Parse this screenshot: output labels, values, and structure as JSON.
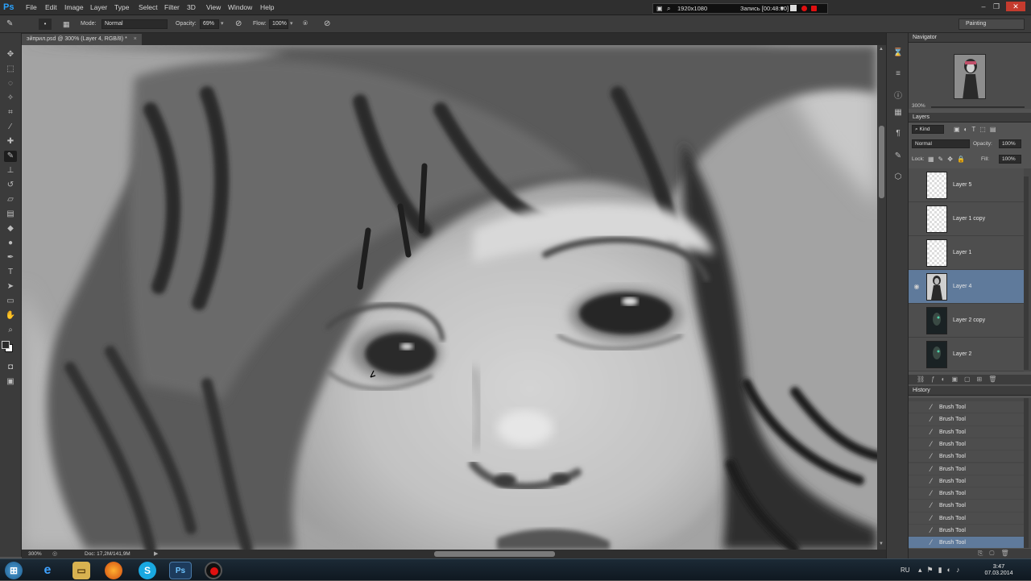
{
  "app": {
    "logo": "Ps",
    "menu": [
      "File",
      "Edit",
      "Image",
      "Layer",
      "Type",
      "Select",
      "Filter",
      "3D",
      "View",
      "Window",
      "Help"
    ]
  },
  "recording": {
    "resolution": "1920x1080",
    "status": "Запись [00:48:00]"
  },
  "options_bar": {
    "mode_label": "Mode:",
    "mode_value": "Normal",
    "opacity_label": "Opacity:",
    "opacity_value": "69%",
    "flow_label": "Flow:",
    "flow_value": "100%",
    "workspace": "Painting"
  },
  "document": {
    "tab_title": "эйприл.psd @ 300% (Layer 4, RGB/8) *",
    "zoom": "300%",
    "doc_info": "Doc: 17,2M/141,9M"
  },
  "navigator": {
    "title": "Navigator",
    "zoom": "300%"
  },
  "layers_panel": {
    "title": "Layers",
    "kind_filter": "Kind",
    "blend_mode": "Normal",
    "opacity_label": "Opacity:",
    "opacity_value": "100%",
    "lock_label": "Lock:",
    "fill_label": "Fill:",
    "fill_value": "100%",
    "layers": [
      {
        "name": "Layer 5",
        "thumb": "checker",
        "visible": false,
        "selected": false
      },
      {
        "name": "Layer 1 copy",
        "thumb": "checker",
        "visible": false,
        "selected": false
      },
      {
        "name": "Layer 1",
        "thumb": "checker",
        "visible": false,
        "selected": false
      },
      {
        "name": "Layer 4",
        "thumb": "figure",
        "visible": true,
        "selected": true
      },
      {
        "name": "Layer 2 copy",
        "thumb": "dark",
        "visible": false,
        "selected": false
      },
      {
        "name": "Layer 2",
        "thumb": "dark",
        "visible": false,
        "selected": false
      }
    ]
  },
  "history_panel": {
    "title": "History",
    "items": [
      "Brush Tool",
      "Brush Tool",
      "Brush Tool",
      "Brush Tool",
      "Brush Tool",
      "Brush Tool",
      "Brush Tool",
      "Brush Tool",
      "Brush Tool",
      "Brush Tool",
      "Brush Tool",
      "Brush Tool"
    ]
  },
  "taskbar": {
    "language": "RU",
    "time": "3:47",
    "date": "07.03.2014"
  },
  "colors": {
    "selection": "#5f7a9b",
    "ps_blue": "#2aa3ff",
    "record_red": "#e01010"
  }
}
